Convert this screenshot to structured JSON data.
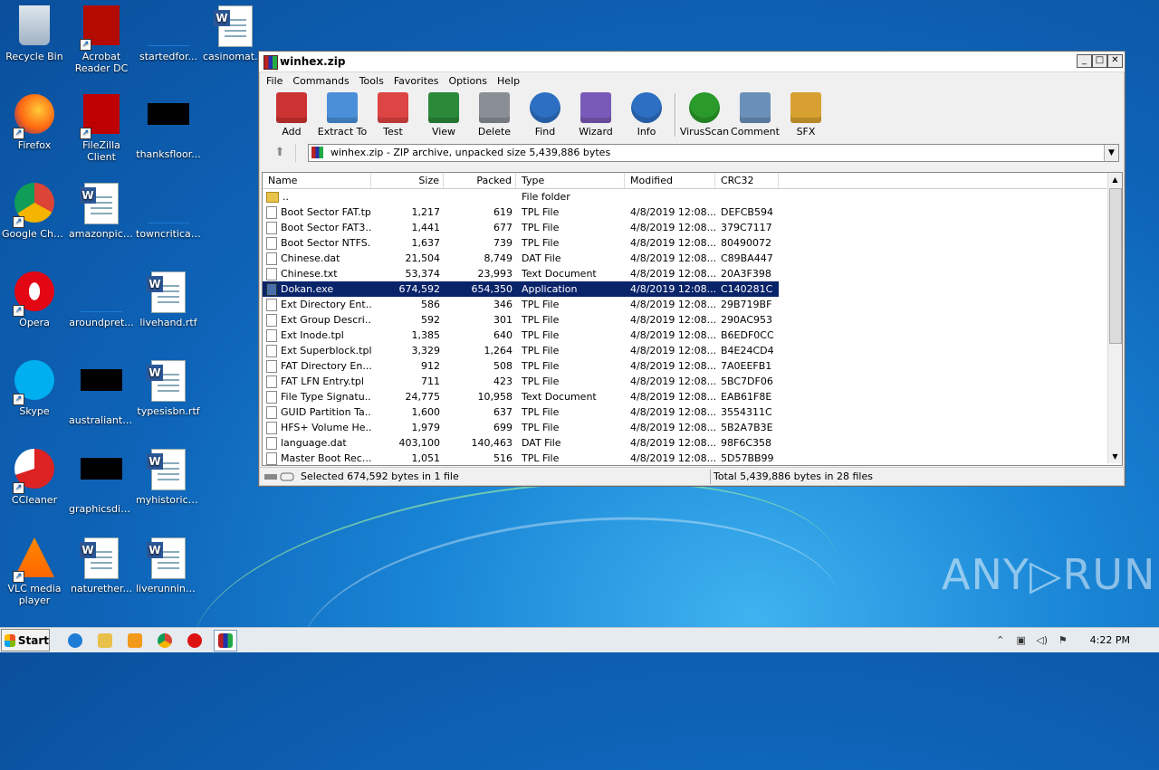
{
  "desktop": {
    "icons": [
      {
        "label": "Recycle Bin",
        "x": 0
      },
      {
        "label": "Acrobat Reader DC"
      },
      {
        "label": "startedfor..."
      },
      {
        "label": "casinomatch..."
      },
      {
        "label": "Firefox"
      },
      {
        "label": "FileZilla Client"
      },
      {
        "label": "thanksfloor..."
      },
      {
        "label": "Google Chrome"
      },
      {
        "label": "amazonpict..."
      },
      {
        "label": "towncritical...."
      },
      {
        "label": "Opera"
      },
      {
        "label": "aroundpret..."
      },
      {
        "label": "livehand.rtf"
      },
      {
        "label": "Skype"
      },
      {
        "label": "australianta..."
      },
      {
        "label": "typesisbn.rtf"
      },
      {
        "label": "CCleaner"
      },
      {
        "label": "graphicsdis..."
      },
      {
        "label": "myhistorical..."
      },
      {
        "label": "VLC media player"
      },
      {
        "label": "naturether..."
      },
      {
        "label": "liverunning.rtf"
      }
    ],
    "watermark": "ANY▷RUN"
  },
  "window": {
    "title": "winhex.zip",
    "menu": [
      "File",
      "Commands",
      "Tools",
      "Favorites",
      "Options",
      "Help"
    ],
    "toolbar": [
      {
        "label": "Add",
        "icon": "add-archive-icon"
      },
      {
        "label": "Extract To",
        "icon": "extract-folder-icon"
      },
      {
        "label": "Test",
        "icon": "test-checklist-icon"
      },
      {
        "label": "View",
        "icon": "view-book-icon"
      },
      {
        "label": "Delete",
        "icon": "trash-icon"
      },
      {
        "label": "Find",
        "icon": "magnifier-icon"
      },
      {
        "label": "Wizard",
        "icon": "wand-icon"
      },
      {
        "label": "Info",
        "icon": "info-icon"
      },
      {
        "label": "VirusScan",
        "icon": "virus-icon"
      },
      {
        "label": "Comment",
        "icon": "comment-icon"
      },
      {
        "label": "SFX",
        "icon": "sfx-box-icon"
      }
    ],
    "address": "winhex.zip - ZIP archive, unpacked size 5,439,886 bytes",
    "columns": [
      "Name",
      "Size",
      "Packed",
      "Type",
      "Modified",
      "CRC32"
    ],
    "rows": [
      {
        "name": "..",
        "size": "",
        "packed": "",
        "type": "File folder",
        "modified": "",
        "crc": "",
        "kind": "folder"
      },
      {
        "name": "Boot Sector FAT.tpl",
        "size": "1,217",
        "packed": "619",
        "type": "TPL File",
        "modified": "4/8/2019 12:08...",
        "crc": "DEFCB594"
      },
      {
        "name": "Boot Sector FAT3...",
        "size": "1,441",
        "packed": "677",
        "type": "TPL File",
        "modified": "4/8/2019 12:08...",
        "crc": "379C7117"
      },
      {
        "name": "Boot Sector NTFS...",
        "size": "1,637",
        "packed": "739",
        "type": "TPL File",
        "modified": "4/8/2019 12:08...",
        "crc": "80490072"
      },
      {
        "name": "Chinese.dat",
        "size": "21,504",
        "packed": "8,749",
        "type": "DAT File",
        "modified": "4/8/2019 12:08...",
        "crc": "C89BA447"
      },
      {
        "name": "Chinese.txt",
        "size": "53,374",
        "packed": "23,993",
        "type": "Text Document",
        "modified": "4/8/2019 12:08...",
        "crc": "20A3F398"
      },
      {
        "name": "Dokan.exe",
        "size": "674,592",
        "packed": "654,350",
        "type": "Application",
        "modified": "4/8/2019 12:08...",
        "crc": "C140281C",
        "kind": "app",
        "selected": true
      },
      {
        "name": "Ext Directory Ent...",
        "size": "586",
        "packed": "346",
        "type": "TPL File",
        "modified": "4/8/2019 12:08...",
        "crc": "29B719BF"
      },
      {
        "name": "Ext Group Descri...",
        "size": "592",
        "packed": "301",
        "type": "TPL File",
        "modified": "4/8/2019 12:08...",
        "crc": "290AC953"
      },
      {
        "name": "Ext Inode.tpl",
        "size": "1,385",
        "packed": "640",
        "type": "TPL File",
        "modified": "4/8/2019 12:08...",
        "crc": "B6EDF0CC"
      },
      {
        "name": "Ext Superblock.tpl",
        "size": "3,329",
        "packed": "1,264",
        "type": "TPL File",
        "modified": "4/8/2019 12:08...",
        "crc": "B4E24CD4"
      },
      {
        "name": "FAT Directory En...",
        "size": "912",
        "packed": "508",
        "type": "TPL File",
        "modified": "4/8/2019 12:08...",
        "crc": "7A0EEFB1"
      },
      {
        "name": "FAT LFN Entry.tpl",
        "size": "711",
        "packed": "423",
        "type": "TPL File",
        "modified": "4/8/2019 12:08...",
        "crc": "5BC7DF06"
      },
      {
        "name": "File Type Signatu...",
        "size": "24,775",
        "packed": "10,958",
        "type": "Text Document",
        "modified": "4/8/2019 12:08...",
        "crc": "EAB61F8E"
      },
      {
        "name": "GUID Partition Ta...",
        "size": "1,600",
        "packed": "637",
        "type": "TPL File",
        "modified": "4/8/2019 12:08...",
        "crc": "3554311C"
      },
      {
        "name": "HFS+ Volume He...",
        "size": "1,979",
        "packed": "699",
        "type": "TPL File",
        "modified": "4/8/2019 12:08...",
        "crc": "5B2A7B3E"
      },
      {
        "name": "language.dat",
        "size": "403,100",
        "packed": "140,463",
        "type": "DAT File",
        "modified": "4/8/2019 12:08...",
        "crc": "98F6C358"
      },
      {
        "name": "Master Boot Rec...",
        "size": "1,051",
        "packed": "516",
        "type": "TPL File",
        "modified": "4/8/2019 12:08...",
        "crc": "5D57BB99"
      }
    ],
    "status_left": "Selected 674,592 bytes in 1 file",
    "status_right": "Total 5,439,886 bytes in 28 files"
  },
  "taskbar": {
    "start": "Start",
    "clock": "4:22 PM"
  }
}
